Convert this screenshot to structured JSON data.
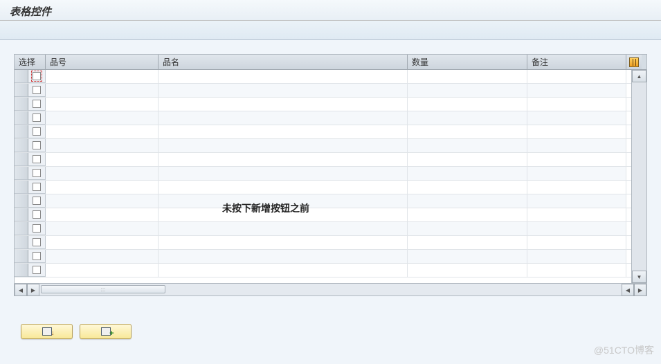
{
  "title": "表格控件",
  "columns": {
    "select": "选择",
    "itemno": "品号",
    "itemname": "品名",
    "qty": "数量",
    "remark": "备注"
  },
  "overlay_caption": "未按下新增按钮之前",
  "rows": [
    {
      "focused": true
    },
    {},
    {},
    {},
    {},
    {},
    {},
    {},
    {},
    {},
    {},
    {},
    {},
    {},
    {}
  ],
  "watermark": "@51CTO博客",
  "icons": {
    "config": "table-config-icon",
    "refresh_btn": "refresh-icon",
    "add_btn": "add-row-icon"
  }
}
